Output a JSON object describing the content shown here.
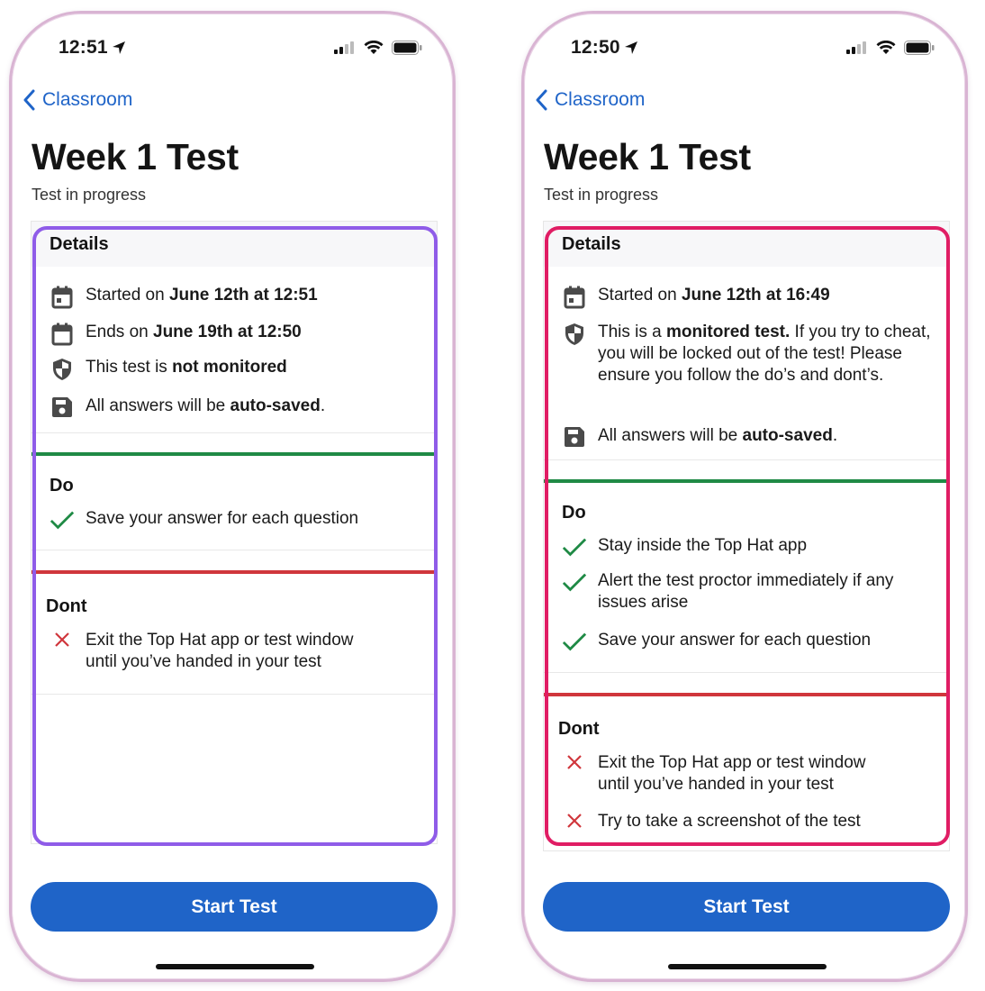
{
  "colors": {
    "accent": "#1f64c8",
    "do_green": "#1f8a45",
    "dont_red": "#d0363c",
    "frame_left": "#8f5ce8",
    "frame_right": "#e01d64"
  },
  "left": {
    "time": "12:51",
    "back_label": "Classroom",
    "title": "Week 1 Test",
    "subtitle": "Test in progress",
    "details_header": "Details",
    "details": [
      {
        "icon": "calendar-icon",
        "pre": "Started on ",
        "bold": "June 12th at 12:51",
        "post": ""
      },
      {
        "icon": "calendar-icon",
        "pre": "Ends on ",
        "bold": "June 19th at 12:50",
        "post": ""
      },
      {
        "icon": "shield-icon",
        "pre": "This test is ",
        "bold": "not monitored",
        "post": ""
      },
      {
        "icon": "save-icon",
        "pre": "All answers will be ",
        "bold": "auto-saved",
        "post": "."
      }
    ],
    "do_header": "Do",
    "do_items": [
      "Save your answer for each question"
    ],
    "dont_header": "Dont",
    "dont_items": [
      "Exit the Top Hat app or test window until you’ve handed in your test"
    ],
    "start_button": "Start Test"
  },
  "right": {
    "time": "12:50",
    "back_label": "Classroom",
    "title": "Week 1 Test",
    "subtitle": "Test in progress",
    "details_header": "Details",
    "details": [
      {
        "icon": "calendar-icon",
        "pre": "Started on ",
        "bold": "June 12th at 16:49",
        "post": ""
      },
      {
        "icon": "shield-icon",
        "pre": "This is a ",
        "bold": "monitored test.",
        "post": " If you try to cheat, you will be locked out of the test! Please ensure you follow the do’s and dont’s."
      },
      {
        "icon": "save-icon",
        "pre": "All answers will be ",
        "bold": "auto-saved",
        "post": "."
      }
    ],
    "do_header": "Do",
    "do_items": [
      "Stay inside the Top Hat app",
      "Alert the test proctor immediately if any issues arise",
      "Save your answer for each question"
    ],
    "dont_header": "Dont",
    "dont_items": [
      "Exit the Top Hat app or test window until you’ve handed in your test",
      "Try to take a screenshot of the test"
    ],
    "start_button": "Start Test"
  }
}
